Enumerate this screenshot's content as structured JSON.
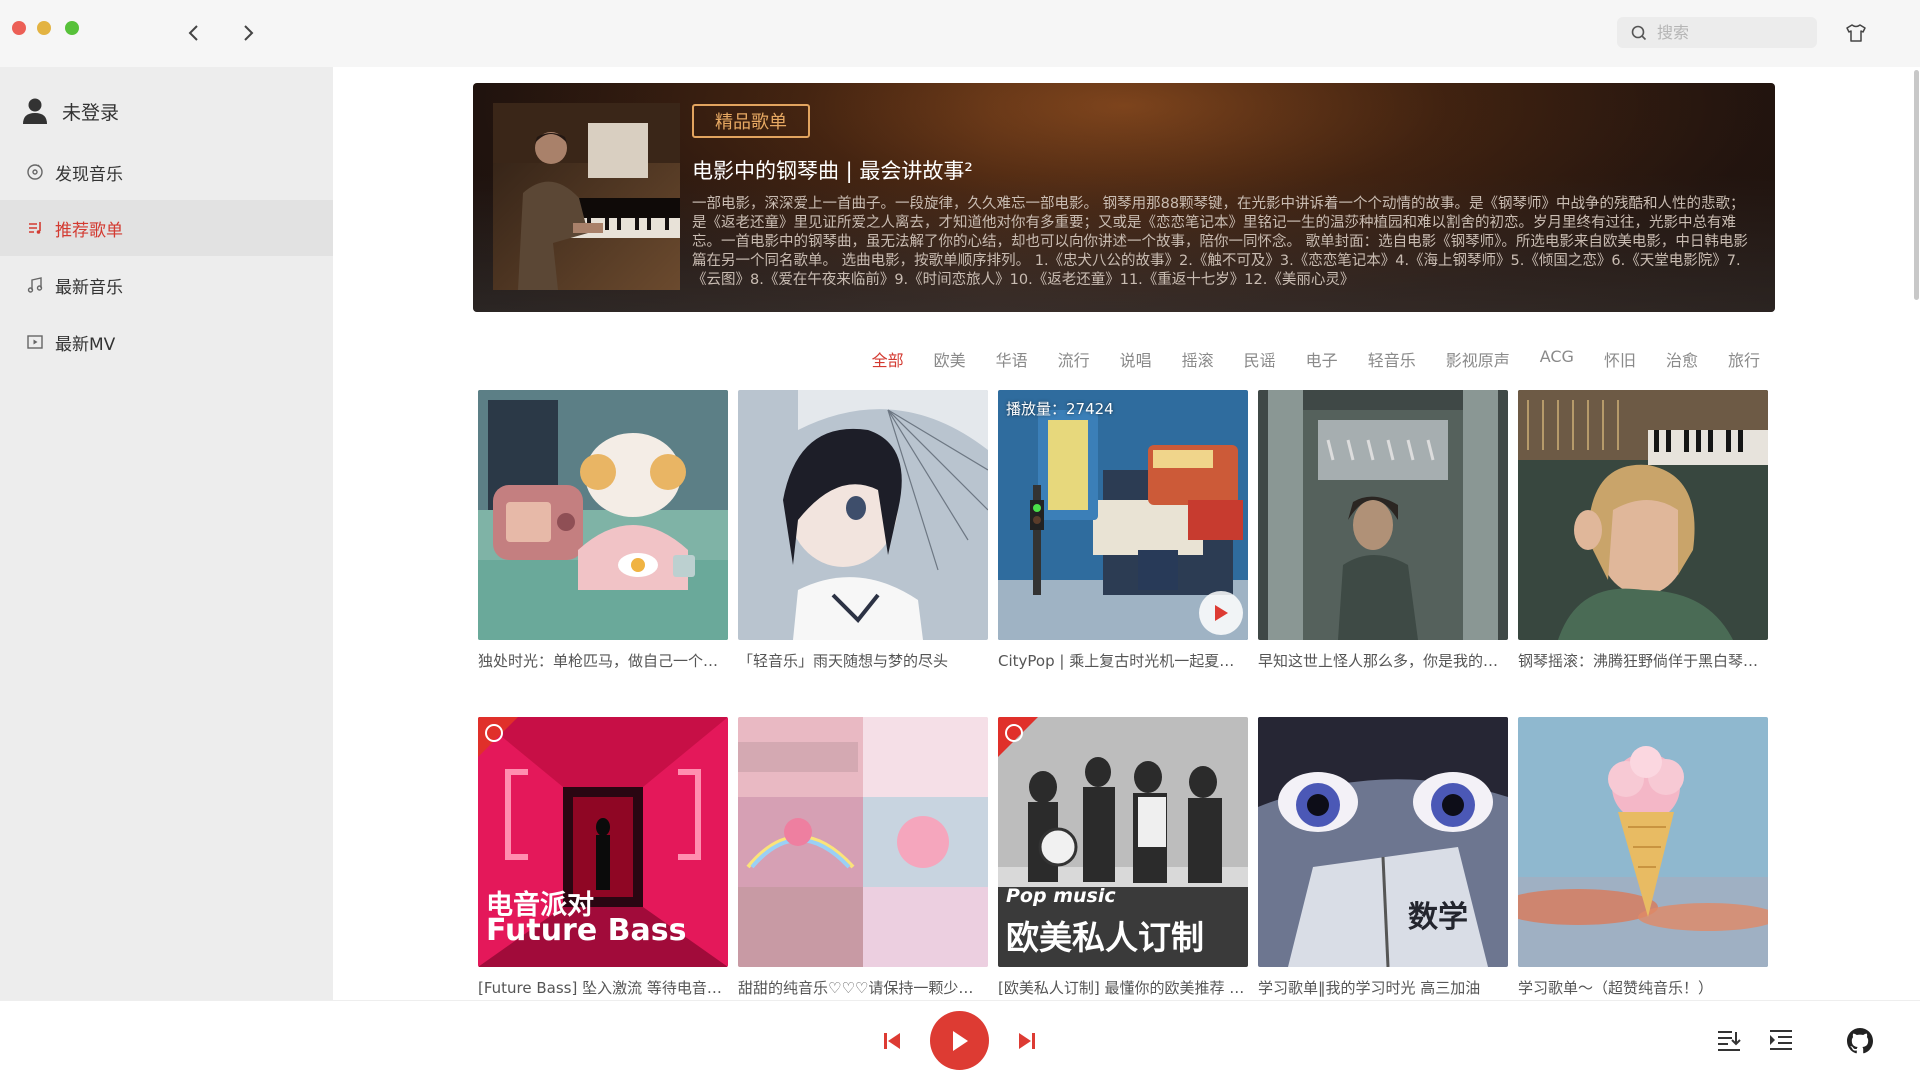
{
  "search": {
    "placeholder": "搜索"
  },
  "user": {
    "label": "未登录"
  },
  "sidebar": {
    "items": [
      {
        "label": "发现音乐",
        "icon": "disc-icon",
        "active": false
      },
      {
        "label": "推荐歌单",
        "icon": "playlist-icon",
        "active": true
      },
      {
        "label": "最新音乐",
        "icon": "music-note-icon",
        "active": false
      },
      {
        "label": "最新MV",
        "icon": "video-icon",
        "active": false
      }
    ]
  },
  "banner": {
    "tag": "精品歌单",
    "title": "电影中的钢琴曲 | 最会讲故事²",
    "description": "一部电影，深深爱上一首曲子。一段旋律，久久难忘一部电影。 钢琴用那88颗琴键，在光影中讲诉着一个个动情的故事。是《钢琴师》中战争的残酷和人性的悲歌；是《返老还童》里见证所爱之人离去，才知道他对你有多重要；又或是《恋恋笔记本》里铭记一生的温莎种植园和难以割舍的初恋。岁月里终有过往，光影中总有难忘。一首电影中的钢琴曲，虽无法解了你的心结，却也可以向你讲述一个故事，陪你一同怀念。 歌单封面：选自电影《钢琴师》。所选电影来自欧美电影，中日韩电影篇在另一个同名歌单。 选曲电影，按歌单顺序排列。 1.《忠犬八公的故事》2.《触不可及》3.《恋恋笔记本》4.《海上钢琴师》5.《倾国之恋》6.《天堂电影院》7.《云图》8.《爱在午夜来临前》9.《时间恋旅人》10.《返老还童》11.《重返十七岁》12.《美丽心灵》"
  },
  "categories": [
    "全部",
    "欧美",
    "华语",
    "流行",
    "说唱",
    "摇滚",
    "民谣",
    "电子",
    "轻音乐",
    "影视原声",
    "ACG",
    "怀旧",
    "治愈",
    "旅行"
  ],
  "active_category": "全部",
  "playlists": [
    {
      "title": "独处时光：单枪匹马，做自己一个人的英雄",
      "playcount": ""
    },
    {
      "title": "「轻音乐」雨天随想与梦的尽头",
      "playcount": ""
    },
    {
      "title": "CityPop | 乘上复古时光机一起夏日兜风",
      "playcount": "播放量：27424"
    },
    {
      "title": "早知这世上怪人那么多，你是我的最爱",
      "playcount": ""
    },
    {
      "title": "钢琴摇滚：沸腾狂野倘佯于黑白琴键之间",
      "playcount": ""
    },
    {
      "title": "[Future Bass] 坠入激流 等待电音浪潮",
      "playcount": "",
      "overlay_line1": "电音派对",
      "overlay_line2": "Future Bass"
    },
    {
      "title": "甜甜的纯音乐♡♡♡请保持一颗少女心",
      "playcount": ""
    },
    {
      "title": "[欧美私人订制] 最懂你的欧美推荐 每日更新",
      "playcount": "",
      "overlay_line1": "Pop music",
      "overlay_line2": "欧美私人订制"
    },
    {
      "title": "学习歌单‖我的学习时光 高三加油",
      "playcount": "",
      "overlay_line1": "数学"
    },
    {
      "title": "学习歌单～（超赞纯音乐！）",
      "playcount": ""
    }
  ],
  "colors": {
    "accent": "#dd3b33",
    "sidebar_bg": "#ededed",
    "banner_tag": "#e6a862"
  }
}
